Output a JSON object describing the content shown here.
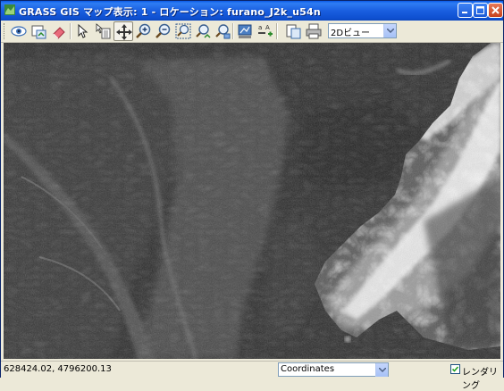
{
  "window": {
    "title": "GRASS GIS マップ表示: 1  - ロケーション: furano_J2k_u54n",
    "icons": [
      "app-icon",
      "minimize-icon",
      "maximize-icon",
      "close-icon"
    ]
  },
  "toolbar": {
    "tools": [
      "display-eye-icon",
      "render-map-icon",
      "erase-icon",
      "pointer-icon",
      "query-icon",
      "pan-icon",
      "zoom-in-icon",
      "zoom-out-icon",
      "zoom-extent-icon",
      "zoom-back-icon",
      "zoom-region-icon",
      "zoom-menu-icon",
      "analyze-icon",
      "overlay-icon",
      "save-icon",
      "print-icon"
    ],
    "active_tool": "pan-icon",
    "view_mode": "2Dビュー"
  },
  "map": {
    "description_icon": "map-canvas"
  },
  "statusbar": {
    "coordinates": "628424.02, 4796200.13",
    "mode_select": "Coordinates",
    "render_label": "レンダリング",
    "render_checked": true
  },
  "colors": {
    "titlebar": "#0e4fcf",
    "window_bg": "#ece9d8",
    "map_dark": "#2a2a2a"
  }
}
